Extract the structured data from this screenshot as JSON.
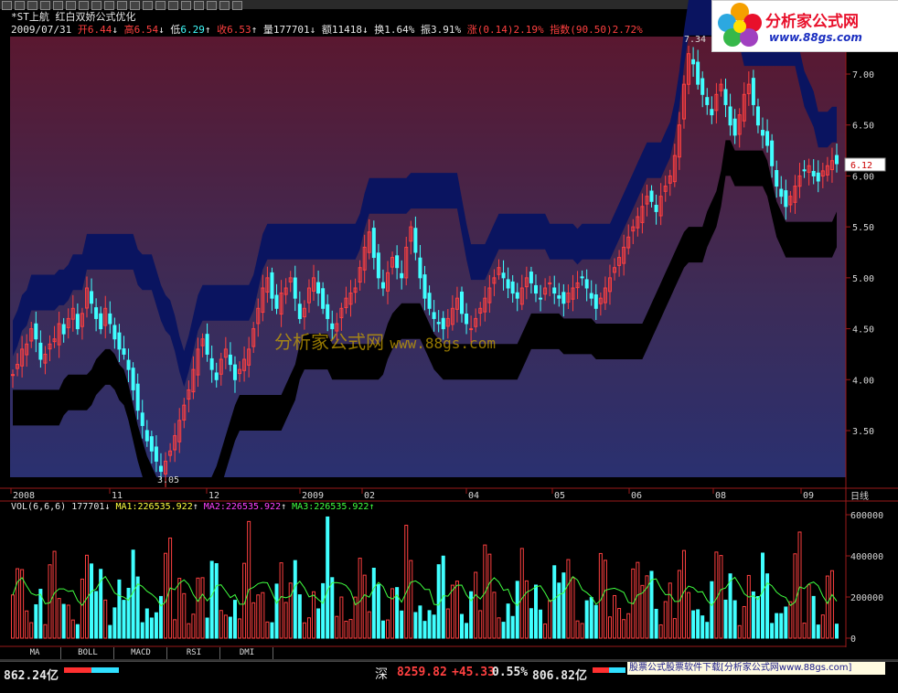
{
  "header": {
    "stock_name": "*ST上航",
    "indicator_name": "红白双娇公式优化",
    "date": "2009/07/31",
    "open_label": "开",
    "open": "6.44",
    "high_label": "高",
    "high": "6.54",
    "low_label": "低",
    "low": "6.29",
    "close_label": "收",
    "close": "6.53",
    "vol_label": "量",
    "vol": "177701",
    "amt_label": "额",
    "amt": "11418",
    "turnover_label": "换",
    "turnover": "1.64%",
    "amp_label": "振",
    "amp": "3.91%",
    "chg_label": "涨",
    "chg": "(0.14)2.19%",
    "index_label": "指数",
    "index": "(90.50)2.72%"
  },
  "logo": {
    "title": "分析家公式网",
    "url": "www.88gs.com"
  },
  "watermark": {
    "text": "分析家公式网",
    "url": "www.88gs.com"
  },
  "price_axis": {
    "ticks": [
      "7.00",
      "6.50",
      "6.00",
      "5.50",
      "5.00",
      "4.50",
      "4.00",
      "3.50"
    ],
    "current": "6.12",
    "high_marker": "7.34",
    "low_marker": "3.05"
  },
  "time_axis": {
    "labels": [
      "2008",
      "11",
      "12",
      "2009",
      "02",
      "04",
      "05",
      "06",
      "08",
      "09"
    ],
    "period": "日线"
  },
  "volume": {
    "name": "VOL(6,6,6)",
    "value": "177701",
    "ma1": "MA1:226535.922",
    "ma2": "MA2:226535.922",
    "ma3": "MA3:226535.922",
    "ticks": [
      "600000",
      "400000",
      "200000",
      "0"
    ]
  },
  "tabs": [
    "MA",
    "BOLL",
    "MACD",
    "RSI",
    "DMI"
  ],
  "statusbar": {
    "left_amount": "862.24亿",
    "sz_label": "深",
    "sz_index": "8259.82",
    "sz_change": "+45.33",
    "sz_pct": "0.55%",
    "sz_amount": "806.82亿",
    "banner": "股票公式股票软件下载[分析家公式网www.88gs.com]"
  },
  "colors": {
    "up": "#ff4040",
    "down": "#40ffff",
    "upper_band": "#0a1460",
    "lower_band": "#000000",
    "ma_line": "#40ff40"
  },
  "chart_data": {
    "type": "candlestick",
    "x": "trading days 2008-10 to 2009-09",
    "ylim": [
      3.0,
      7.4
    ],
    "closes": [
      4.05,
      4.15,
      4.3,
      4.35,
      4.5,
      4.4,
      4.2,
      4.25,
      4.35,
      4.4,
      4.55,
      4.45,
      4.6,
      4.7,
      4.5,
      4.65,
      4.9,
      4.75,
      4.6,
      4.5,
      4.7,
      4.55,
      4.4,
      4.3,
      4.25,
      4.1,
      3.9,
      3.7,
      3.55,
      3.4,
      3.3,
      3.2,
      3.1,
      3.2,
      3.3,
      3.45,
      3.6,
      3.75,
      3.9,
      4.1,
      4.3,
      4.4,
      4.25,
      4.1,
      4.0,
      4.2,
      4.3,
      4.15,
      4.0,
      4.1,
      4.2,
      4.3,
      4.5,
      4.7,
      4.9,
      5.0,
      4.8,
      4.7,
      4.85,
      4.9,
      5.0,
      4.8,
      4.6,
      4.7,
      4.9,
      5.0,
      4.85,
      4.7,
      4.6,
      4.5,
      4.55,
      4.7,
      4.8,
      4.85,
      4.9,
      5.1,
      5.3,
      5.45,
      5.2,
      5.0,
      4.9,
      5.05,
      5.2,
      5.1,
      5.0,
      5.3,
      5.5,
      5.25,
      5.0,
      4.8,
      4.7,
      4.6,
      4.55,
      4.5,
      4.6,
      4.7,
      4.8,
      4.65,
      4.55,
      4.5,
      4.6,
      4.7,
      4.8,
      4.9,
      5.0,
      5.1,
      5.0,
      4.9,
      4.85,
      4.8,
      4.9,
      5.0,
      4.95,
      4.85,
      4.8,
      4.9,
      4.95,
      4.85,
      4.8,
      4.75,
      4.85,
      4.9,
      4.95,
      5.0,
      4.9,
      4.8,
      4.7,
      4.8,
      4.9,
      5.0,
      5.1,
      5.2,
      5.3,
      5.4,
      5.5,
      5.6,
      5.7,
      5.8,
      5.75,
      5.65,
      5.8,
      5.9,
      6.0,
      6.2,
      6.5,
      6.9,
      7.2,
      7.1,
      6.9,
      6.8,
      6.7,
      6.6,
      6.8,
      6.9,
      6.7,
      6.5,
      6.4,
      6.6,
      6.8,
      6.9,
      6.7,
      6.5,
      6.4,
      6.3,
      6.1,
      5.9,
      5.8,
      5.7,
      5.8,
      5.9,
      6.0,
      6.05,
      6.1,
      6.0,
      5.95,
      6.05,
      6.1,
      6.15,
      6.12
    ],
    "volume_ylim": [
      0,
      620000
    ]
  }
}
